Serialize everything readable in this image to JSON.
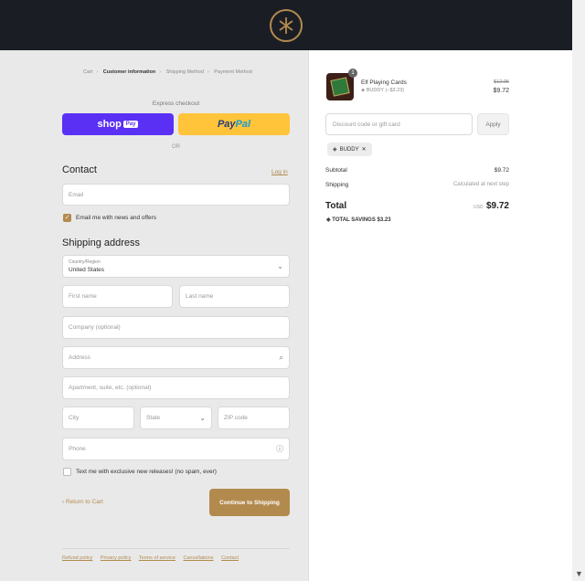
{
  "breadcrumb": [
    "Cart",
    "Customer information",
    "Shipping Method",
    "Payment Method"
  ],
  "express_checkout": {
    "label": "Express checkout",
    "shop_label": "shop",
    "shop_pay_badge": "Pay",
    "paypal_pay": "Pay",
    "paypal_pal": "Pal",
    "or_label": "OR"
  },
  "contact": {
    "heading": "Contact",
    "login_link": "Log in",
    "email_placeholder": "Email",
    "newsletter_label": "Email me with news and offers",
    "newsletter_checked": true
  },
  "shipping": {
    "heading": "Shipping address",
    "country_label": "Country/Region",
    "country_value": "United States",
    "first_name_placeholder": "First name",
    "last_name_placeholder": "Last name",
    "company_placeholder": "Company (optional)",
    "address_placeholder": "Address",
    "apartment_placeholder": "Apartment, suite, etc. (optional)",
    "city_placeholder": "City",
    "state_placeholder": "State",
    "zip_placeholder": "ZIP code",
    "phone_placeholder": "Phone",
    "sms_label": "Text me with exclusive new releases! (no spam, ever)",
    "sms_checked": false
  },
  "actions": {
    "return_label": "Return to Cart",
    "continue_label": "Continue to Shipping"
  },
  "footer_links": [
    "Refund policy",
    "Privacy policy",
    "Terms of service",
    "Cancellations",
    "Contact"
  ],
  "order": {
    "quantity": "1",
    "product_name": "Elf Playing Cards",
    "product_discount": "BUDDY (−$3.23)",
    "price_original": "$12.95",
    "price_final": "$9.72",
    "discount_placeholder": "Discount code or gift card",
    "apply_label": "Apply",
    "applied_code": "BUDDY",
    "subtotal_label": "Subtotal",
    "subtotal_value": "$9.72",
    "shipping_label": "Shipping",
    "shipping_value": "Calculated at next step",
    "total_label": "Total",
    "currency": "USD",
    "total_value": "$9.72",
    "savings_label": "TOTAL SAVINGS",
    "savings_value": "$3.23"
  },
  "colors": {
    "accent": "#b38a4e",
    "header_bg": "#1a1e24",
    "shop_pay": "#5a31f4",
    "paypal": "#ffc439"
  }
}
